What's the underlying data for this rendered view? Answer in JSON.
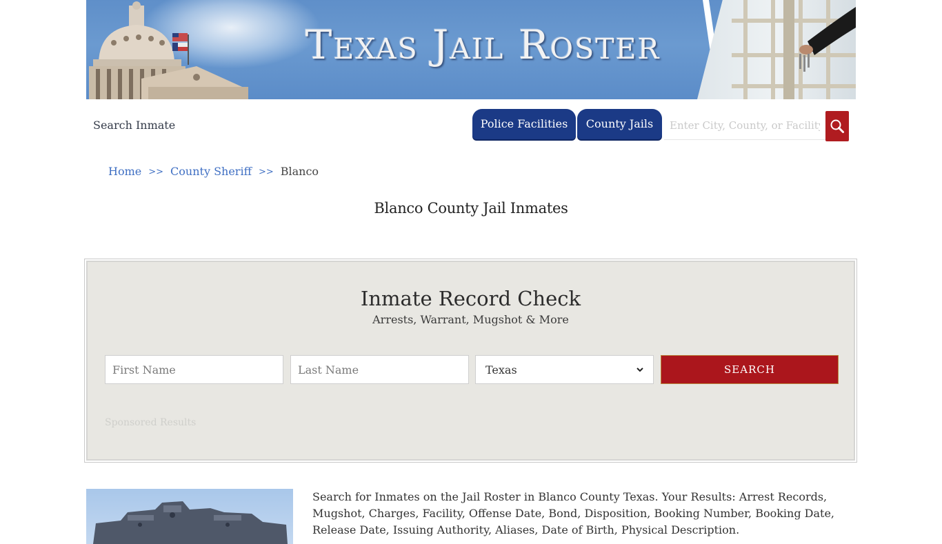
{
  "banner": {
    "title": "Texas Jail Roster",
    "image_alt": "Texas Capitol dome and jail cell door banner"
  },
  "nav": {
    "search_inmate": "Search Inmate",
    "tabs": [
      {
        "label": "Police Facilities"
      },
      {
        "label": "County Jails"
      }
    ],
    "facility_search_placeholder": "Enter City, County, or Facility",
    "search_icon": "search-icon"
  },
  "breadcrumb": {
    "items": [
      {
        "label": "Home"
      },
      {
        "label": "County Sheriff"
      },
      {
        "label": "Blanco"
      }
    ],
    "separator": ">>"
  },
  "page": {
    "title": "Blanco County Jail Inmates"
  },
  "record_check": {
    "title": "Inmate Record Check",
    "subtitle": "Arrests, Warrant, Mugshot & More",
    "first_name_placeholder": "First Name",
    "last_name_placeholder": "Last Name",
    "state_selected": "Texas",
    "search_label": "SEARCH",
    "sponsored_label": "Sponsored Results"
  },
  "intro": {
    "text": "Search for Inmates on the Jail Roster in Blanco County Texas. Your Results: Arrest Records, Mugshot, Charges, Facility, Offense Date, Bond, Disposition, Booking Number, Booking Date, Release Date, Issuing Authority, Aliases, Date of Birth, Physical Description."
  },
  "colors": {
    "nav_blue": "#1b3a86",
    "accent_red": "#ab161c",
    "link_blue": "#3f6fc3",
    "panel_bg": "#e8e7e2"
  }
}
